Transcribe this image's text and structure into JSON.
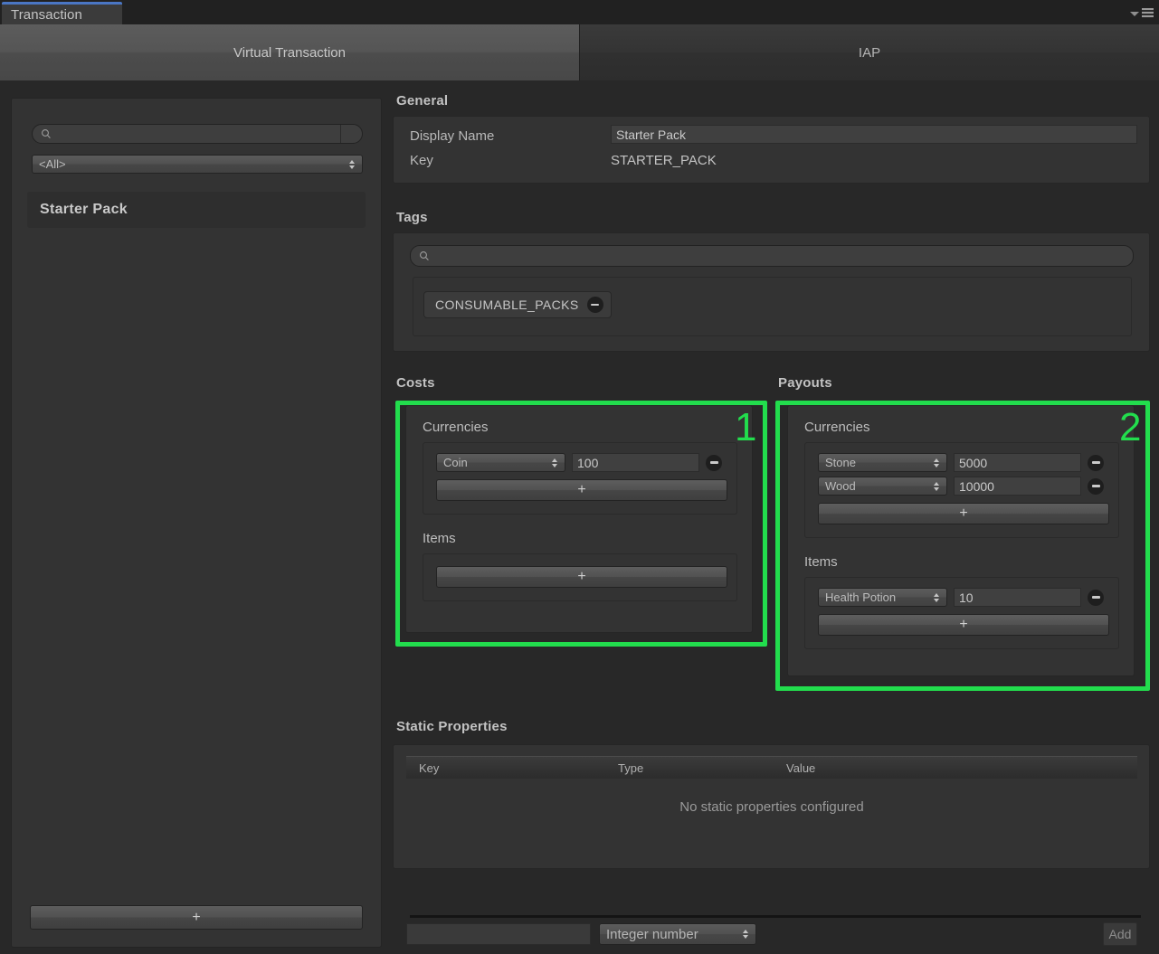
{
  "window": {
    "tab_title": "Transaction",
    "menu_icon": "hamburger-menu-icon",
    "caret_icon": "chevron-down-icon"
  },
  "mode_tabs": [
    {
      "label": "Virtual Transaction",
      "active": true
    },
    {
      "label": "IAP",
      "active": false
    }
  ],
  "sidebar": {
    "search": {
      "placeholder": "",
      "value": "",
      "icon": "search-icon"
    },
    "filter_dropdown": {
      "value": "<All>"
    },
    "items": [
      {
        "label": "Starter Pack",
        "selected": true
      }
    ],
    "add_button_label": "+"
  },
  "general": {
    "title": "General",
    "display_name_label": "Display Name",
    "display_name_value": "Starter Pack",
    "key_label": "Key",
    "key_value": "STARTER_PACK"
  },
  "tags": {
    "title": "Tags",
    "search": {
      "placeholder": "",
      "value": "",
      "icon": "search-icon"
    },
    "chips": [
      {
        "label": "CONSUMABLE_PACKS",
        "remove_icon": "minus-circle-icon"
      }
    ]
  },
  "costs": {
    "title": "Costs",
    "highlight_number": "1",
    "currencies": {
      "title": "Currencies",
      "rows": [
        {
          "name": "Coin",
          "amount": "100",
          "remove_icon": "minus-circle-icon"
        }
      ],
      "add_label": "+"
    },
    "items": {
      "title": "Items",
      "rows": [],
      "add_label": "+"
    }
  },
  "payouts": {
    "title": "Payouts",
    "highlight_number": "2",
    "currencies": {
      "title": "Currencies",
      "rows": [
        {
          "name": "Stone",
          "amount": "5000",
          "remove_icon": "minus-circle-icon"
        },
        {
          "name": "Wood",
          "amount": "10000",
          "remove_icon": "minus-circle-icon"
        }
      ],
      "add_label": "+"
    },
    "items": {
      "title": "Items",
      "rows": [
        {
          "name": "Health Potion",
          "amount": "10",
          "remove_icon": "minus-circle-icon"
        }
      ],
      "add_label": "+"
    }
  },
  "static_properties": {
    "title": "Static Properties",
    "columns": [
      "Key",
      "Type",
      "Value"
    ],
    "empty_message": "No static properties configured",
    "new_key_value": "",
    "new_key_placeholder": "",
    "new_type_value": "Integer number",
    "add_label": "Add"
  },
  "colors": {
    "highlight_green": "#22dd4d",
    "tab_accent_blue": "#4a76c4",
    "panel_bg": "#333333",
    "window_bg": "#282828"
  }
}
